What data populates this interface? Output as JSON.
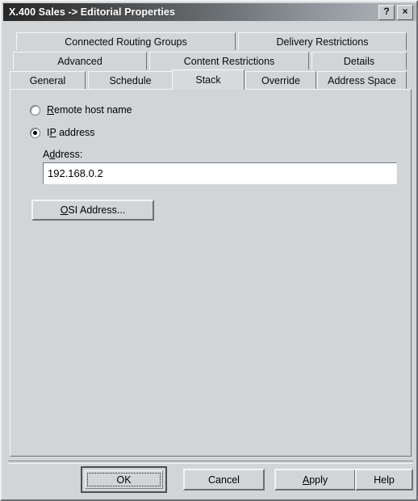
{
  "window": {
    "title": "X.400 Sales -> Editorial Properties",
    "help_button": "?",
    "close_button": "×"
  },
  "tabs": {
    "rows": [
      [
        {
          "label": "Connected Routing Groups",
          "selected": false
        },
        {
          "label": "Delivery Restrictions",
          "selected": false
        }
      ],
      [
        {
          "label": "Advanced",
          "selected": false
        },
        {
          "label": "Content Restrictions",
          "selected": false
        },
        {
          "label": "Details",
          "selected": false
        }
      ],
      [
        {
          "label": "General",
          "selected": false
        },
        {
          "label": "Schedule",
          "selected": false
        },
        {
          "label": "Stack",
          "selected": true
        },
        {
          "label": "Override",
          "selected": false
        },
        {
          "label": "Address Space",
          "selected": false
        }
      ]
    ],
    "selected_tab": "Stack"
  },
  "stack_panel": {
    "transport_options": [
      {
        "label": "Remote host name",
        "accel": "R",
        "selected": false
      },
      {
        "label": "IP address",
        "accel": "P",
        "selected": true
      }
    ],
    "address_label": "Address:",
    "address_label_accel": "d",
    "address_value": "192.168.0.2",
    "address_placeholder": "",
    "osi_button_label": "OSI Address...",
    "osi_button_accel": "O"
  },
  "footer": {
    "ok_label": "OK",
    "cancel_label": "Cancel",
    "apply_label": "Apply",
    "apply_accel": "A",
    "help_label": "Help",
    "default_button": "OK"
  },
  "colors": {
    "dialog_face": "#d2d5d8",
    "titlebar_dark": "#272727",
    "titlebar_light": "#b3b8bc",
    "field_background": "#ffffff",
    "text": "#000000",
    "shadow": "#6e7175",
    "highlight": "#f4f5f6"
  }
}
